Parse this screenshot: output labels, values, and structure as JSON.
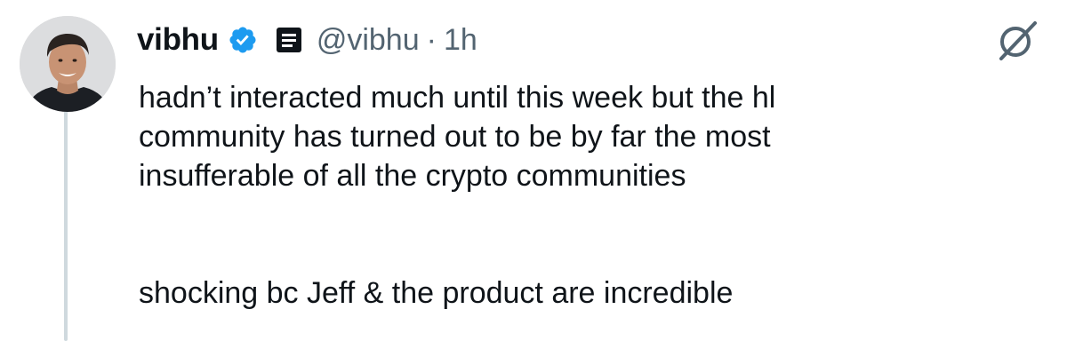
{
  "tweet": {
    "display_name": "vibhu",
    "handle": "@vibhu",
    "separator": "·",
    "time": "1h",
    "verified": true,
    "accent_color": "#1d9bf0",
    "icons": [
      "verified-badge-icon",
      "article-icon",
      "grok-icon",
      "avatar"
    ],
    "text": {
      "line_1": "hadn’t interacted much until this week but the hl",
      "line_2": "community has turned out to be by far the most",
      "line_3": "insufferable of all the crypto communities",
      "line_4": "shocking bc Jeff & the product are incredible"
    }
  }
}
